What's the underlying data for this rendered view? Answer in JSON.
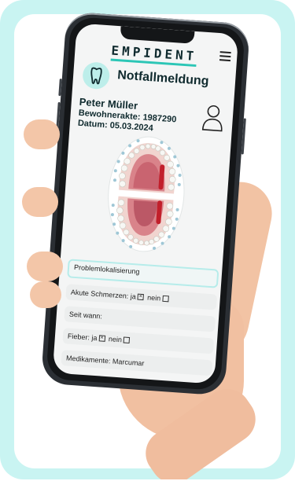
{
  "app": {
    "logo_text": "EMPIDENT",
    "page_title": "Notfallmeldung",
    "accent_color": "#2cc6b6",
    "background_color": "#c9f4f2"
  },
  "patient": {
    "name": "Peter Müller",
    "record_line": "Bewohnerakte: 1987290",
    "date_line": "Datum: 05.03.2024"
  },
  "icons": {
    "menu": "hamburger-menu-icon",
    "tooth": "tooth-icon",
    "user": "user-icon",
    "chart": "dental-chart-icon"
  },
  "fields": {
    "problem": "Problemlokalisierung",
    "pain_label": "Akute Schmerzen:",
    "yes_label": "ja",
    "no_label": "nein",
    "since_label": "Seit wann:",
    "fever_label": "Fieber:",
    "meds_label": "Medikamente:",
    "meds_value": "Marcumar"
  }
}
